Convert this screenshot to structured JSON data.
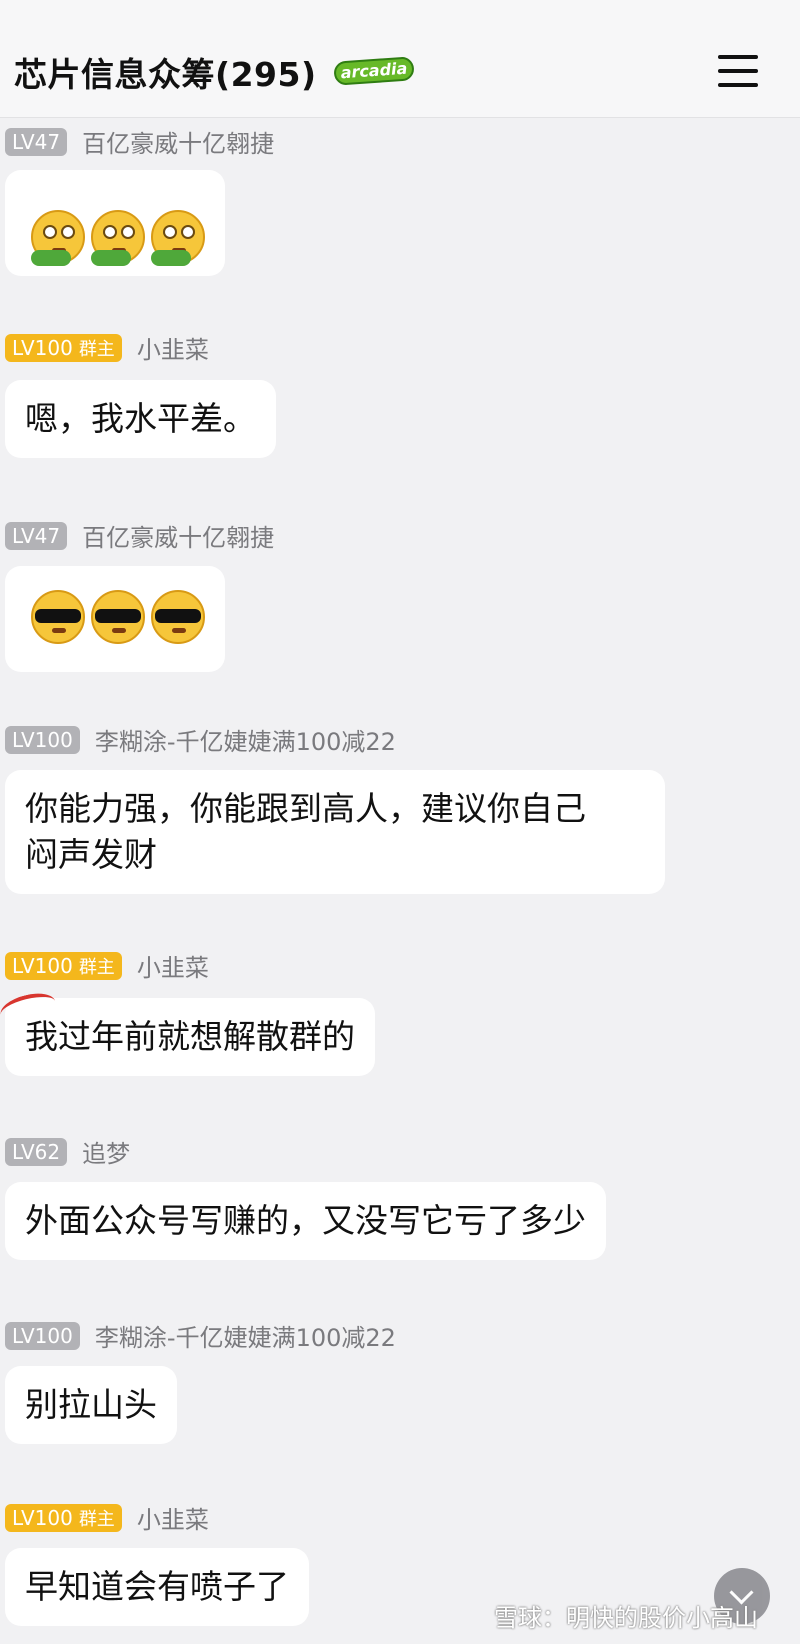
{
  "header": {
    "title": "芯片信息众筹(295)",
    "logo_text": "arcadia",
    "menu_icon": "hamburger-menu-icon"
  },
  "messages": [
    {
      "level": "LV47",
      "role": "",
      "name": "百亿豪威十亿翱捷",
      "text": "",
      "emoji": "worried-scarf-emoji x3"
    },
    {
      "level": "LV100",
      "role": "群主",
      "name": "小韭菜",
      "text": "嗯，我水平差。"
    },
    {
      "level": "LV47",
      "role": "",
      "name": "百亿豪威十亿翱捷",
      "text": "",
      "emoji": "sunglasses-emoji x3"
    },
    {
      "level": "LV100",
      "role": "",
      "name": "李糊涂-千亿婕婕满100减22",
      "text_line1": "你能力强，你能跟到高人，建议你自己",
      "text_line2": "闷声发财"
    },
    {
      "level": "LV100",
      "role": "群主",
      "name": "小韭菜",
      "text": "我过年前就想解散群的"
    },
    {
      "level": "LV62",
      "role": "",
      "name": "追梦",
      "text": "外面公众号写赚的，又没写它亏了多少"
    },
    {
      "level": "LV100",
      "role": "",
      "name": "李糊涂-千亿婕婕满100减22",
      "text": "别拉山头"
    },
    {
      "level": "LV100",
      "role": "群主",
      "name": "小韭菜",
      "text": "早知道会有喷子了"
    }
  ],
  "watermark": "雪球：明快的股价小高山",
  "colors": {
    "owner_badge": "#f4b71c",
    "level_badge": "#b2b2b6",
    "background": "#f1f1f3",
    "bubble": "#ffffff"
  }
}
